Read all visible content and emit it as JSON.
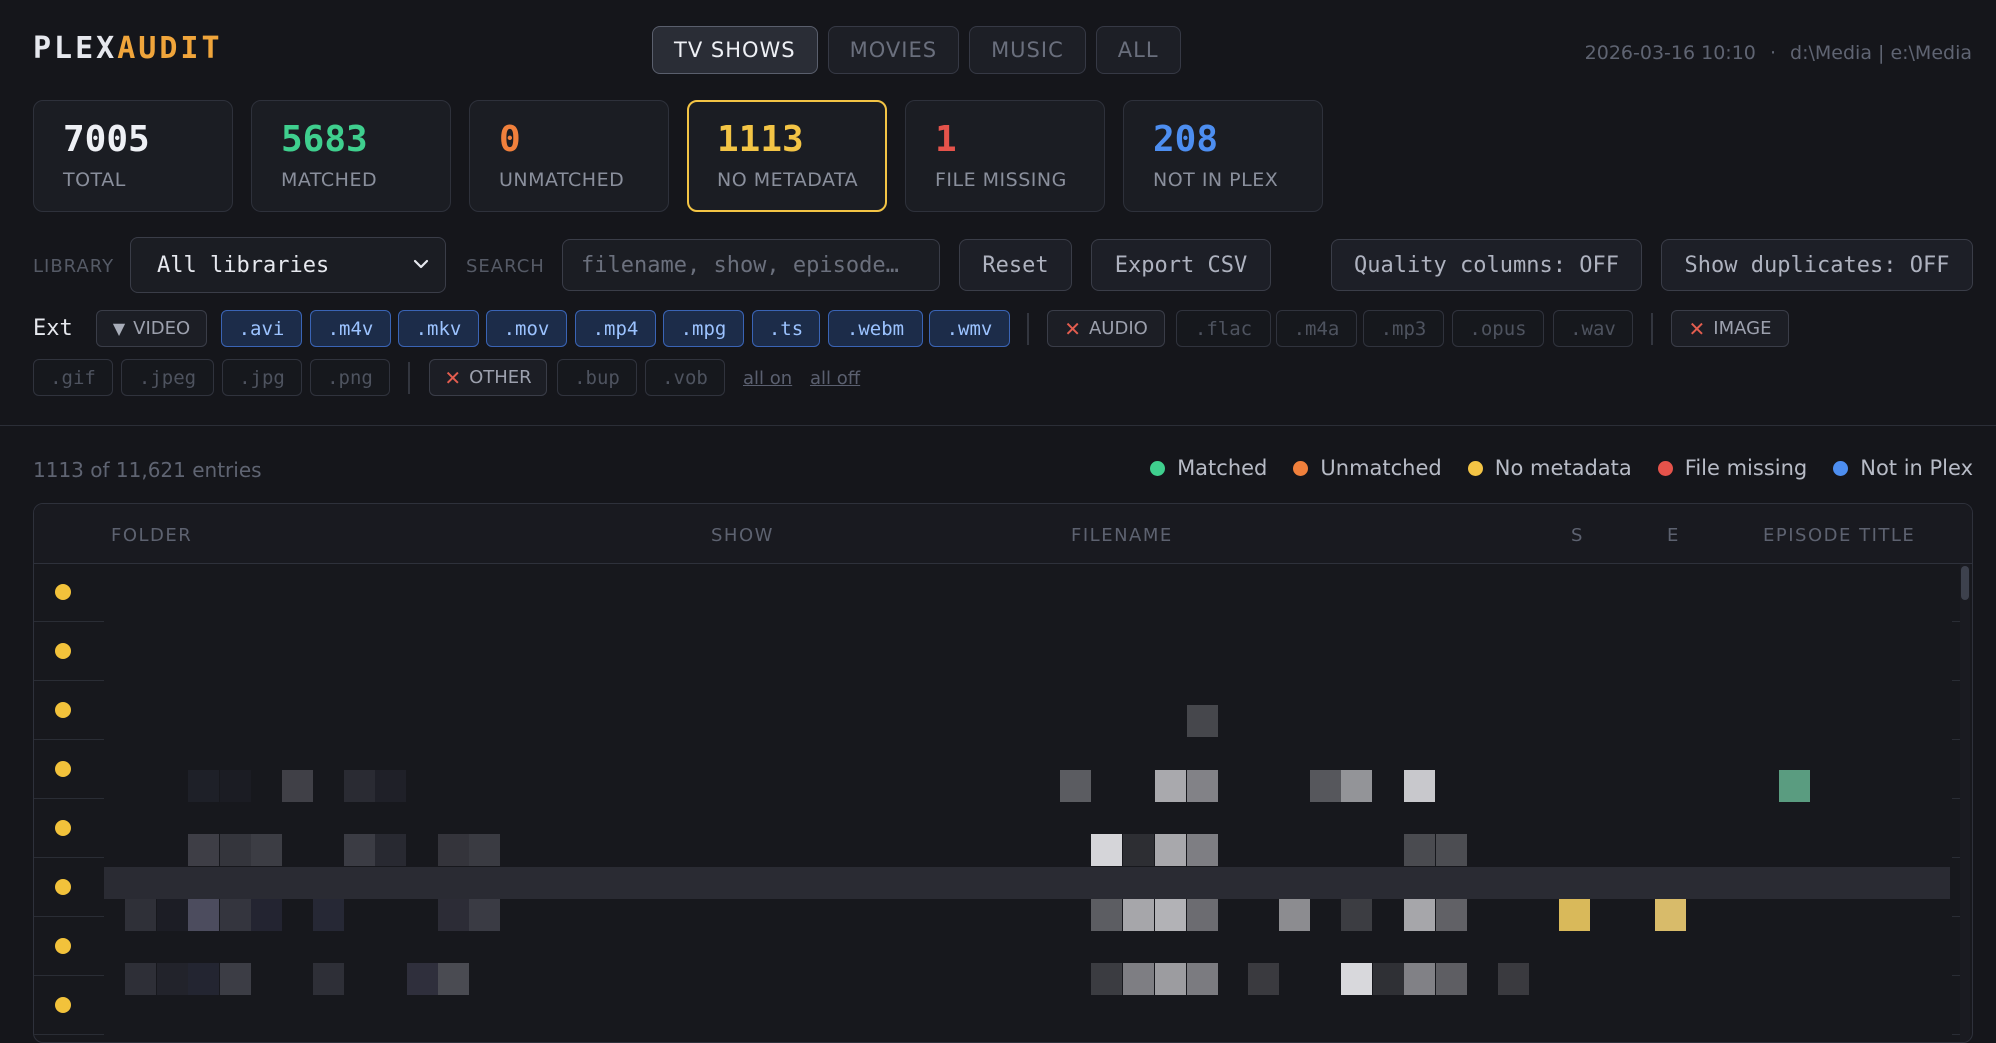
{
  "brand": {
    "part1": "PLEX",
    "part2": "AUDIT"
  },
  "tabs": [
    {
      "label": "TV SHOWS",
      "active": true
    },
    {
      "label": "MOVIES",
      "active": false
    },
    {
      "label": "MUSIC",
      "active": false
    },
    {
      "label": "ALL",
      "active": false
    }
  ],
  "meta": {
    "datetime": "2026-03-16 10:10",
    "separator": "·",
    "paths": "d:\\Media | e:\\Media"
  },
  "stats": [
    {
      "value": "7005",
      "label": "TOTAL",
      "color": "#eef0f5"
    },
    {
      "value": "5683",
      "label": "MATCHED",
      "color": "#3fcf8e"
    },
    {
      "value": "0",
      "label": "UNMATCHED",
      "color": "#f0803c"
    },
    {
      "value": "1113",
      "label": "NO METADATA",
      "color": "#f3c445",
      "selected": true
    },
    {
      "value": "1",
      "label": "FILE MISSING",
      "color": "#e5534b"
    },
    {
      "value": "208",
      "label": "NOT IN PLEX",
      "color": "#4d8ef0"
    }
  ],
  "filters": {
    "library_label": "LIBRARY",
    "library_value": "All libraries",
    "search_label": "SEARCH",
    "search_placeholder": "filename, show, episode…",
    "reset": "Reset",
    "export": "Export CSV",
    "quality": "Quality columns: OFF",
    "duplicates": "Show duplicates: OFF"
  },
  "ext": {
    "label": "Ext",
    "video_group": "VIDEO",
    "video": [
      ".avi",
      ".m4v",
      ".mkv",
      ".mov",
      ".mp4",
      ".mpg",
      ".ts",
      ".webm",
      ".wmv"
    ],
    "audio_group": "AUDIO",
    "audio": [
      ".flac",
      ".m4a",
      ".mp3",
      ".opus",
      ".wav"
    ],
    "image_group": "IMAGE",
    "image": [
      ".gif",
      ".jpeg",
      ".jpg",
      ".png"
    ],
    "other_group": "OTHER",
    "other": [
      ".bup",
      ".vob"
    ],
    "all_on": "all on",
    "all_off": "all off"
  },
  "list": {
    "count": "1113 of 11,621 entries",
    "legend": [
      {
        "label": "Matched",
        "color": "#3fcf8e"
      },
      {
        "label": "Unmatched",
        "color": "#f0803c"
      },
      {
        "label": "No metadata",
        "color": "#f3c445"
      },
      {
        "label": "File missing",
        "color": "#e5534b"
      },
      {
        "label": "Not in Plex",
        "color": "#4d8ef0"
      }
    ],
    "columns": {
      "folder": "FOLDER",
      "show": "SHOW",
      "filename": "FILENAME",
      "s": "S",
      "e": "E",
      "title": "EPISODE TITLE"
    },
    "row_status_color": "#f2c23b"
  }
}
